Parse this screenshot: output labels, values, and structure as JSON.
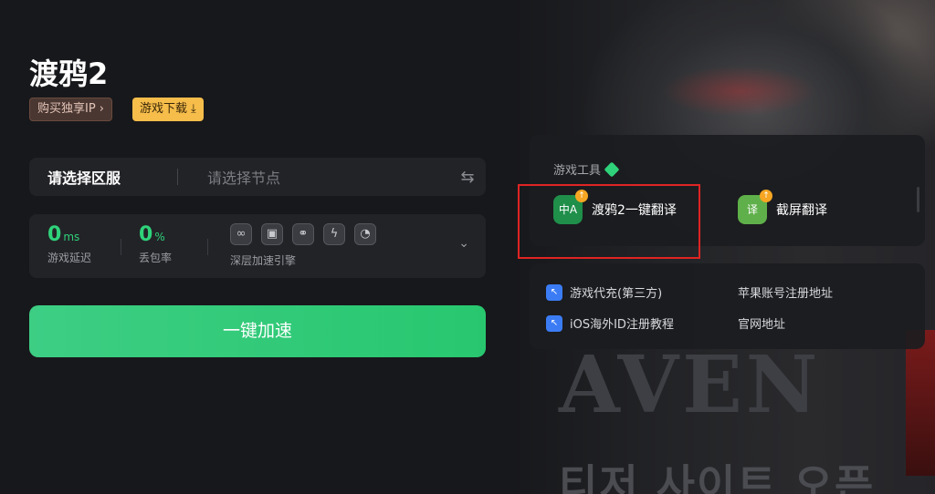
{
  "game": {
    "title": "渡鸦2"
  },
  "tags": {
    "ip_label": "购买独享IP",
    "ip_arrow": "›",
    "download_label": "游戏下载",
    "download_icon": "⤓"
  },
  "server": {
    "region_placeholder": "请选择区服",
    "node_placeholder": "请选择节点",
    "swap_icon": "⇆"
  },
  "stats": {
    "latency": {
      "value": "0",
      "unit": "ms",
      "label": "游戏延迟"
    },
    "loss": {
      "value": "0",
      "unit": "%",
      "label": "丢包率"
    },
    "engine_label": "深层加速引擎",
    "engine_icons": [
      "link-icon",
      "window-icon",
      "nodes-icon",
      "bolt-icon",
      "gauge-icon"
    ],
    "chevron": "⌄"
  },
  "boost_button": "一键加速",
  "tools": {
    "title": "游戏工具",
    "items": [
      {
        "label": "渡鸦2一键翻译",
        "icon_text": "中A",
        "badge": "↑"
      },
      {
        "label": "截屏翻译",
        "icon_text": "译",
        "badge": "↑"
      }
    ]
  },
  "links": [
    {
      "label": "游戏代充(第三方)"
    },
    {
      "label": "苹果账号注册地址"
    },
    {
      "label": "iOS海外ID注册教程"
    },
    {
      "label": "官网地址"
    }
  ],
  "background": {
    "game_logo_text": "AVEN",
    "korean_text": "티저 사이트 오픈"
  },
  "colors": {
    "accent": "#2fd27a",
    "download_tag": "#f6bd4a",
    "highlight": "#e02424"
  }
}
